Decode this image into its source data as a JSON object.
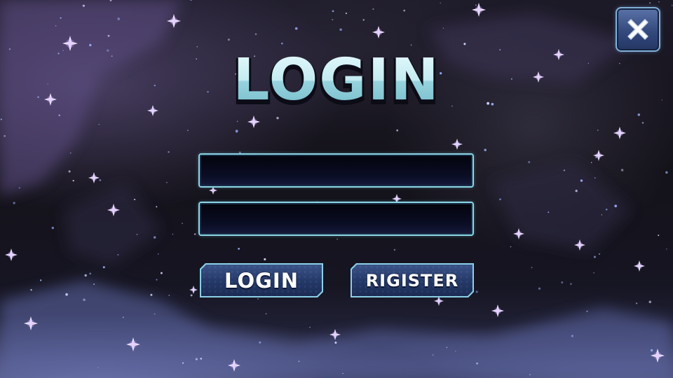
{
  "screen": {
    "title": "LOGIN"
  },
  "form": {
    "username": {
      "value": "",
      "placeholder": ""
    },
    "password": {
      "value": "",
      "placeholder": ""
    }
  },
  "buttons": {
    "login_label": "LOGIN",
    "register_label": "RIGISTER",
    "close_icon": "close-icon"
  },
  "colors": {
    "title_fill_top": "#cdeef2",
    "title_fill_bottom": "#7ec6d3",
    "field_border": "#8ad6e4",
    "button_fill": "#2a4274",
    "button_border": "#8ccfe6",
    "close_fill": "#3e5488"
  }
}
